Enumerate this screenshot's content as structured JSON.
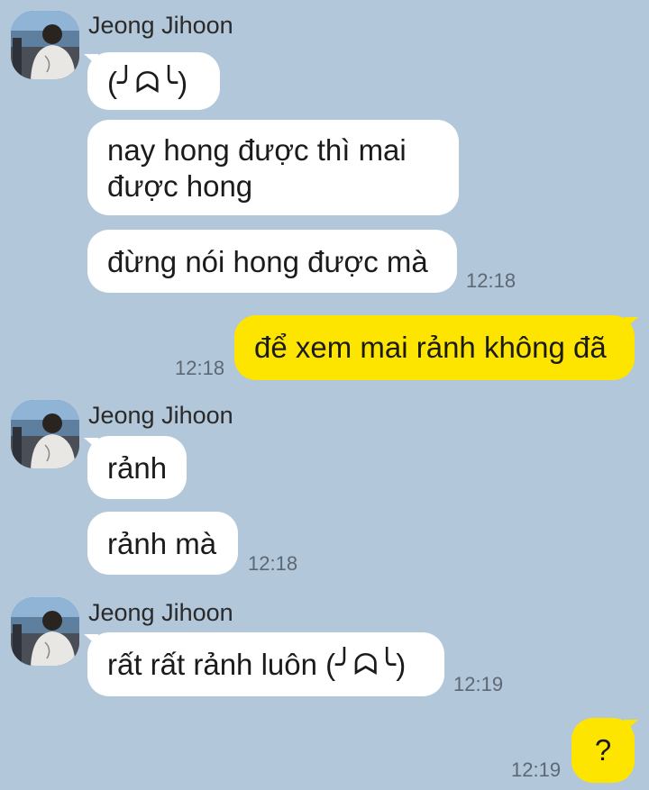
{
  "colors": {
    "background": "#b2c7d9",
    "incoming_bubble": "#ffffff",
    "outgoing_bubble": "#fee500",
    "timestamp": "#5d6874"
  },
  "messages": {
    "g1": {
      "sender": "Jeong Jihoon",
      "avatar_icon": "profile-photo-icon",
      "m1": "(╯ᗣ╰)",
      "m2": "nay hong được thì mai được hong",
      "m3": "đừng nói hong được mà",
      "time": "12:18"
    },
    "me1": {
      "text": "để xem mai rảnh không đã",
      "time": "12:18"
    },
    "g2": {
      "sender": "Jeong Jihoon",
      "avatar_icon": "profile-photo-icon",
      "m1": "rảnh",
      "m2": "rảnh mà",
      "time": "12:18"
    },
    "g3": {
      "sender": "Jeong Jihoon",
      "avatar_icon": "profile-photo-icon",
      "m1": "rất rất rảnh luôn (╯ᗣ╰)",
      "time": "12:19"
    },
    "me2": {
      "text": "?",
      "time": "12:19"
    }
  }
}
